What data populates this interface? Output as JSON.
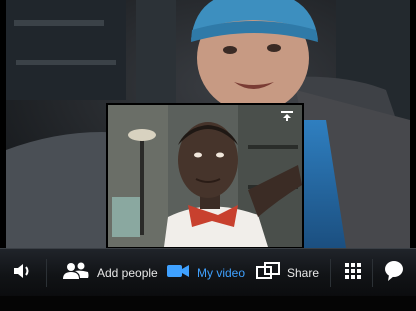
{
  "toolbar": {
    "volume": {
      "icon": "speaker-icon"
    },
    "add_people": {
      "label": "Add people",
      "icon": "people-icon"
    },
    "my_video": {
      "label": "My video",
      "icon": "camera-icon",
      "active": true,
      "color": "#3fa1ff"
    },
    "share": {
      "label": "Share",
      "icon": "share-screen-icon"
    },
    "apps": {
      "icon": "apps-grid-icon"
    },
    "chat": {
      "icon": "chat-bubble-icon"
    }
  },
  "pip": {
    "handle_icon": "drag-handle-icon"
  },
  "colors": {
    "accent": "#3fa1ff",
    "toolbar_bg": "#111316",
    "label": "#e8e8e8"
  }
}
